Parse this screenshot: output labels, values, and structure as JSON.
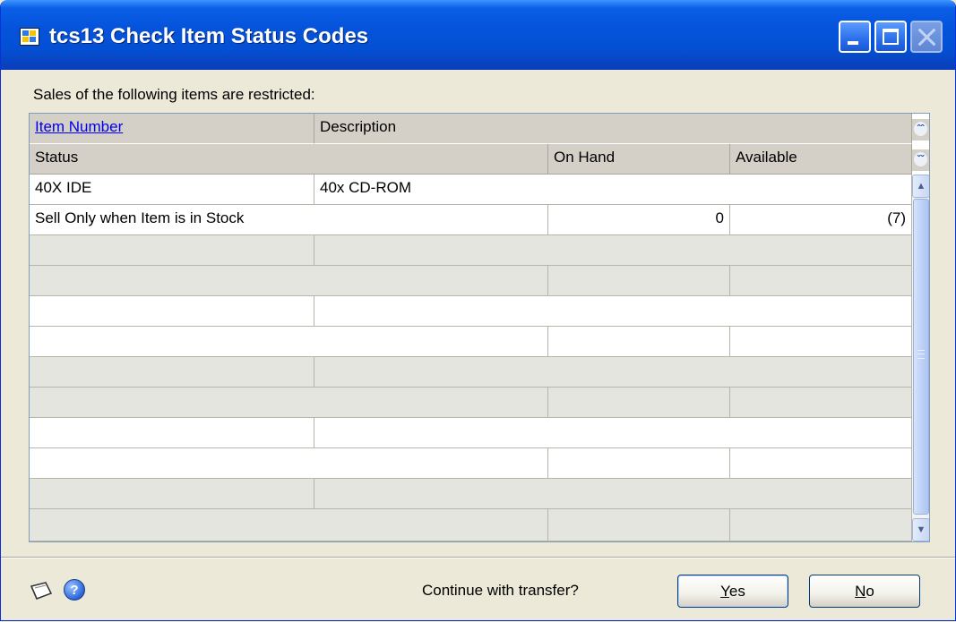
{
  "window": {
    "title": "tcs13 Check Item Status Codes"
  },
  "message": "Sales of the following items are restricted:",
  "grid": {
    "header1": {
      "item_number": "Item Number",
      "description": "Description"
    },
    "header2": {
      "status": "Status",
      "on_hand": "On Hand",
      "available": "Available"
    },
    "rows": [
      {
        "item_number": "40X IDE",
        "description": "40x CD-ROM",
        "status": "Sell Only when Item is in Stock",
        "on_hand": "0",
        "available": "(7)"
      }
    ]
  },
  "footer": {
    "prompt": "Continue with transfer?",
    "yes_label": "Yes",
    "no_label": "No",
    "yes_mnemonic": "Y",
    "yes_rest": "es",
    "no_mnemonic": "N",
    "no_rest": "o"
  },
  "icons": {
    "window_icon": "dynamics-window-icon",
    "note": "note-icon",
    "help": "help-icon",
    "expand": "double-chevron-up-icon",
    "collapse": "double-chevron-down-icon"
  },
  "colors": {
    "titlebar": "#0553DB",
    "window_bg": "#ECE9D8",
    "link": "#0000EE",
    "header_bg": "#D4D0C8"
  }
}
